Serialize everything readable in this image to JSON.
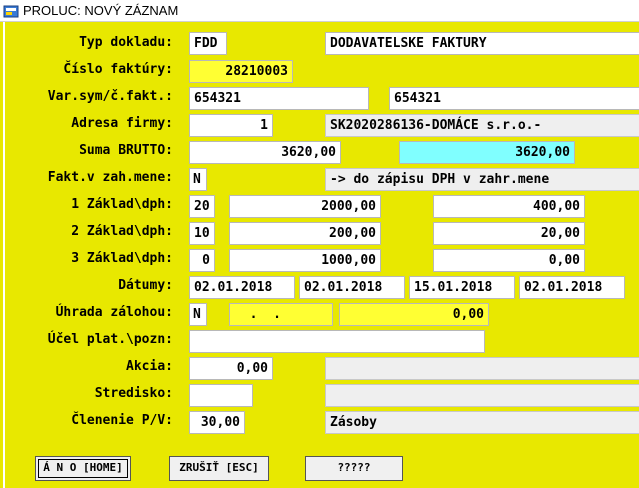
{
  "window": {
    "title": "PROLUC: NOVÝ ZÁZNAM"
  },
  "labels": {
    "typ_dokladu": "Typ dokladu:",
    "cislo_faktury": "Číslo faktúry:",
    "var_sym": "Var.sym/č.fakt.:",
    "adresa_firmy": "Adresa firmy:",
    "suma_brutto": "Suma BRUTTO:",
    "fakt_zah_mene": "Fakt.v zah.mene:",
    "zaklad1": "1 Základ\\dph:",
    "zaklad2": "2 Základ\\dph:",
    "zaklad3": "3 Základ\\dph:",
    "datumy": "Dátumy:",
    "uhrada_zalohou": "Úhrada zálohou:",
    "ucel_plat": "Účel plat.\\pozn:",
    "akcia": "Akcia:",
    "stredisko": "Stredisko:",
    "clenenie": "Členenie P/V:"
  },
  "fields": {
    "typ_dokladu": "FDD",
    "typ_dokladu_desc": "DODAVATELSKE FAKTURY",
    "cislo_faktury": "28210003",
    "var_sym": "654321",
    "cislo_fakt": "654321",
    "adresa_cislo": "1",
    "adresa_nazov": "SK2020286136-DOMÁCE s.r.o.-",
    "suma_brutto": "3620,00",
    "suma_brutto_calc": "3620,00",
    "zah_mena": "N",
    "zah_mena_desc": "-> do zápisu DPH v zahr.mene",
    "dph1_sadzba": "20",
    "dph1_zaklad": "2000,00",
    "dph1_dan": "400,00",
    "dph2_sadzba": "10",
    "dph2_zaklad": "200,00",
    "dph2_dan": "20,00",
    "dph3_sadzba": "0",
    "dph3_zaklad": "1000,00",
    "dph3_dan": "0,00",
    "datum1": "02.01.2018",
    "datum2": "02.01.2018",
    "datum3": "15.01.2018",
    "datum4": "02.01.2018",
    "uhrada_flag": "N",
    "uhrada_datum": "  .  .",
    "uhrada_suma": "0,00",
    "ucel_plat": "",
    "akcia": "0,00",
    "akcia_desc": "",
    "stredisko": "",
    "stredisko_desc": "",
    "clenenie": "30,00",
    "clenenie_desc": "Zásoby"
  },
  "buttons": {
    "ano": "Á N O [HOME]",
    "zrusit": "ZRUŠIŤ [ESC]",
    "help": "?????"
  }
}
